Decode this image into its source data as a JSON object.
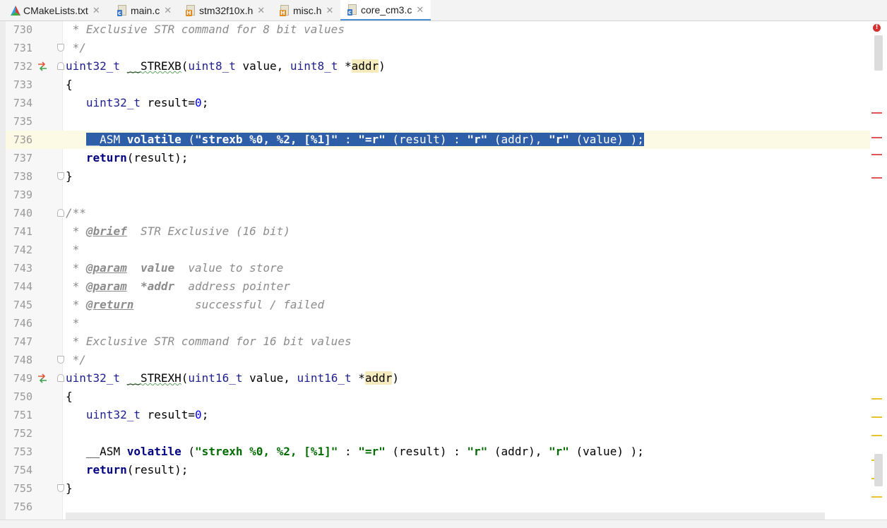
{
  "tabs": [
    {
      "label": "CMakeLists.txt",
      "icon": "cmake-icon",
      "active": false
    },
    {
      "label": "main.c",
      "icon": "c-file-icon",
      "active": false
    },
    {
      "label": "stm32f10x.h",
      "icon": "h-file-icon",
      "active": false
    },
    {
      "label": "misc.h",
      "icon": "h-file-icon",
      "active": false
    },
    {
      "label": "core_cm3.c",
      "icon": "c-file-icon",
      "active": true
    }
  ],
  "editor": {
    "lines": [
      {
        "num": "730"
      },
      {
        "num": "731"
      },
      {
        "num": "732"
      },
      {
        "num": "733"
      },
      {
        "num": "734"
      },
      {
        "num": "735"
      },
      {
        "num": "736"
      },
      {
        "num": "737"
      },
      {
        "num": "738"
      },
      {
        "num": "739"
      },
      {
        "num": "740"
      },
      {
        "num": "741"
      },
      {
        "num": "742"
      },
      {
        "num": "743"
      },
      {
        "num": "744"
      },
      {
        "num": "745"
      },
      {
        "num": "746"
      },
      {
        "num": "747"
      },
      {
        "num": "748"
      },
      {
        "num": "749"
      },
      {
        "num": "750"
      },
      {
        "num": "751"
      },
      {
        "num": "752"
      },
      {
        "num": "753"
      },
      {
        "num": "754"
      },
      {
        "num": "755"
      },
      {
        "num": "756"
      }
    ],
    "code": {
      "l730": " * Exclusive STR command for 8 bit values",
      "l731": " */",
      "l732_type": "uint32_t",
      "l732_fn": "__STREXB",
      "l732_t1": "uint8_t",
      "l732_p1": "value",
      "l732_t2": "uint8_t",
      "l732_p2": "addr",
      "l733": "{",
      "l734_type": "uint32_t",
      "l734_var": "result",
      "l734_num": "0",
      "l736_asm": "__ASM",
      "l736_kw": "volatile",
      "l736_s1": "\"strexb %0, %2, [%1]\"",
      "l736_s2": "\"=r\"",
      "l736_s3": "\"r\"",
      "l736_s4": "\"r\"",
      "l737_kw": "return",
      "l737_rest": "(result);",
      "l738": "}",
      "l740": "/**",
      "l741_tag": "@brief",
      "l741_text": "STR Exclusive (16 bit)",
      "l742": " *",
      "l743_tag": "@param",
      "l743_name": "value",
      "l743_text": "value to store",
      "l744_tag": "@param",
      "l744_name": "*addr",
      "l744_text": "address pointer",
      "l745_tag": "@return",
      "l745_text": "successful / failed",
      "l746": " *",
      "l747": " * Exclusive STR command for 16 bit values",
      "l748": " */",
      "l749_type": "uint32_t",
      "l749_fn": "__STREXH",
      "l749_t1": "uint16_t",
      "l749_p1": "value",
      "l749_t2": "uint16_t",
      "l749_p2": "addr",
      "l750": "{",
      "l751_type": "uint32_t",
      "l751_var": "result",
      "l751_num": "0",
      "l753_asm": "__ASM",
      "l753_kw": "volatile",
      "l753_s1": "\"strexh %0, %2, [%1]\"",
      "l753_s2": "\"=r\"",
      "l753_s3": "\"r\"",
      "l753_s4": "\"r\"",
      "l754_kw": "return",
      "l754_rest": "(result);",
      "l755": "}"
    }
  },
  "colors": {
    "selection": "#2f5ea8",
    "error_stripe": "#e05555",
    "warning_stripe": "#e8c42a",
    "active_tab_underline": "#4a90d9"
  }
}
